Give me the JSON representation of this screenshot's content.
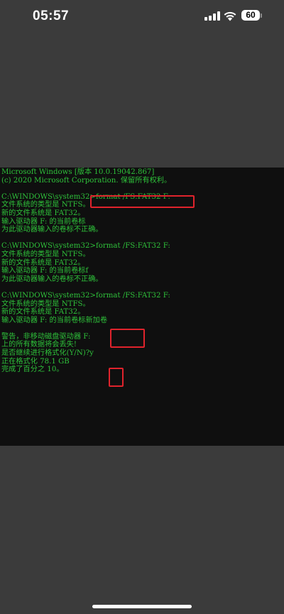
{
  "status_bar": {
    "time": "05:57",
    "battery_level": "60",
    "icons": [
      "cellular-signal-icon",
      "wifi-icon",
      "battery-icon"
    ]
  },
  "console": {
    "text_color": "#2ec13a",
    "background": "#0f0f0f",
    "lines": [
      "Microsoft Windows [版本 10.0.19042.867]",
      "(c) 2020 Microsoft Corporation. 保留所有权利。",
      "",
      "C:\\WINDOWS\\system32>format /FS:FAT32 F:",
      "文件系统的类型是 NTFS。",
      "新的文件系统是 FAT32。",
      "输入驱动器 F: 的当前卷标",
      "为此驱动器输入的卷标不正确。",
      "",
      "C:\\WINDOWS\\system32>format /FS:FAT32 F:",
      "文件系统的类型是 NTFS。",
      "新的文件系统是 FAT32。",
      "输入驱动器 F: 的当前卷标f",
      "为此驱动器输入的卷标不正确。",
      "",
      "C:\\WINDOWS\\system32>format /FS:FAT32 F:",
      "文件系统的类型是 NTFS。",
      "新的文件系统是 FAT32。",
      "输入驱动器 F: 的当前卷标新加卷",
      "",
      "警告，非移动磁盘驱动器 F:",
      "上的所有数据将会丢失!",
      "是否继续进行格式化(Y/N)?y",
      "正在格式化 78.1 GB",
      "完成了百分之 10。"
    ]
  },
  "annotations": {
    "color": "#e0232c"
  }
}
